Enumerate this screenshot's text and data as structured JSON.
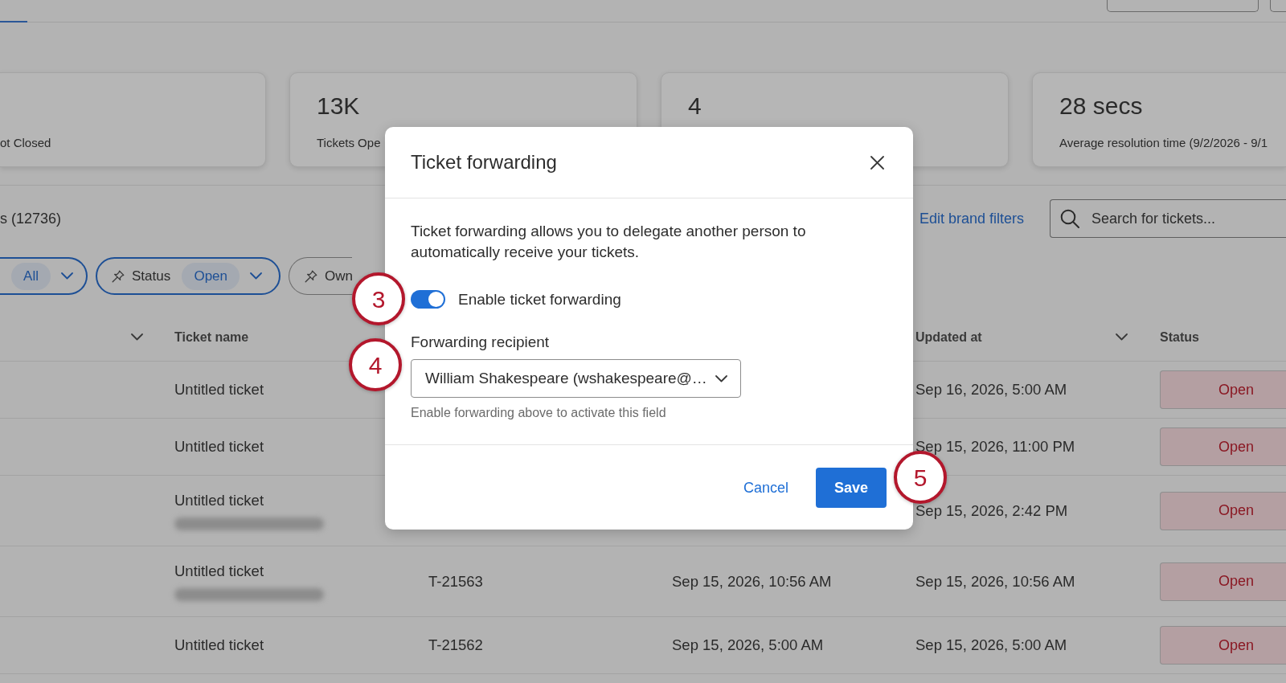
{
  "stats": [
    {
      "label": "ot Closed"
    },
    {
      "value": "13K",
      "label": "Tickets Ope"
    },
    {
      "value": "4"
    },
    {
      "value": "28 secs",
      "label": "Average resolution time (9/2/2026 - 9/1"
    }
  ],
  "tickets": {
    "title": "s (12736)",
    "edit_link": "Edit brand filters",
    "search": {
      "placeholder": "Search for tickets..."
    }
  },
  "filters": [
    {
      "value": "All",
      "active": true,
      "pinned": false
    },
    {
      "label": "Status",
      "value": "Open",
      "active": true,
      "pinned": true
    },
    {
      "label": "Own",
      "active": false,
      "pinned": true
    }
  ],
  "table": {
    "columns": [
      {
        "menu": true
      },
      {
        "label": "Ticket name",
        "menu": false
      },
      {
        "label": "Updated at",
        "menu": true
      },
      {
        "label": "Status",
        "menu": false
      }
    ],
    "rows": [
      {
        "ticket_name": "Untitled ticket",
        "detail_blurred": false,
        "updated_at": "Sep 16, 2026, 5:00 AM",
        "status": "Open"
      },
      {
        "ticket_name": "Untitled ticket",
        "detail_blurred": false,
        "updated_at": "Sep 15, 2026, 11:00 PM",
        "status": "Open"
      },
      {
        "ticket_name": "Untitled ticket",
        "detail_blurred": true,
        "updated_at": "Sep 15, 2026, 2:42 PM",
        "status": "Open"
      },
      {
        "ticket_name": "Untitled ticket",
        "detail_blurred": true,
        "column_3": "T-21563",
        "column_4": "Sep 15, 2026, 10:56 AM",
        "updated_at": "Sep 15, 2026, 10:56 AM",
        "status": "Open"
      },
      {
        "ticket_name": "Untitled ticket",
        "detail_blurred": false,
        "column_3": "T-21562",
        "column_4": "Sep 15, 2026, 5:00 AM",
        "updated_at": "Sep 15, 2026, 5:00 AM",
        "status": "Open"
      }
    ]
  },
  "dialog": {
    "title": "Ticket forwarding",
    "description": "Ticket forwarding allows you to delegate another person to automatically receive your tickets.",
    "toggle": {
      "label": "Enable ticket forwarding",
      "on": true
    },
    "recipient": {
      "label": "Forwarding recipient",
      "value": "William Shakespeare (wshakespeare@…",
      "hint": "Enable forwarding above to activate this field"
    },
    "actions": [
      {
        "label": "Cancel",
        "kind": "link"
      },
      {
        "label": "Save",
        "kind": "primary"
      }
    ]
  },
  "annotations": [
    {
      "number": "3"
    },
    {
      "number": "4"
    },
    {
      "number": "5"
    }
  ]
}
